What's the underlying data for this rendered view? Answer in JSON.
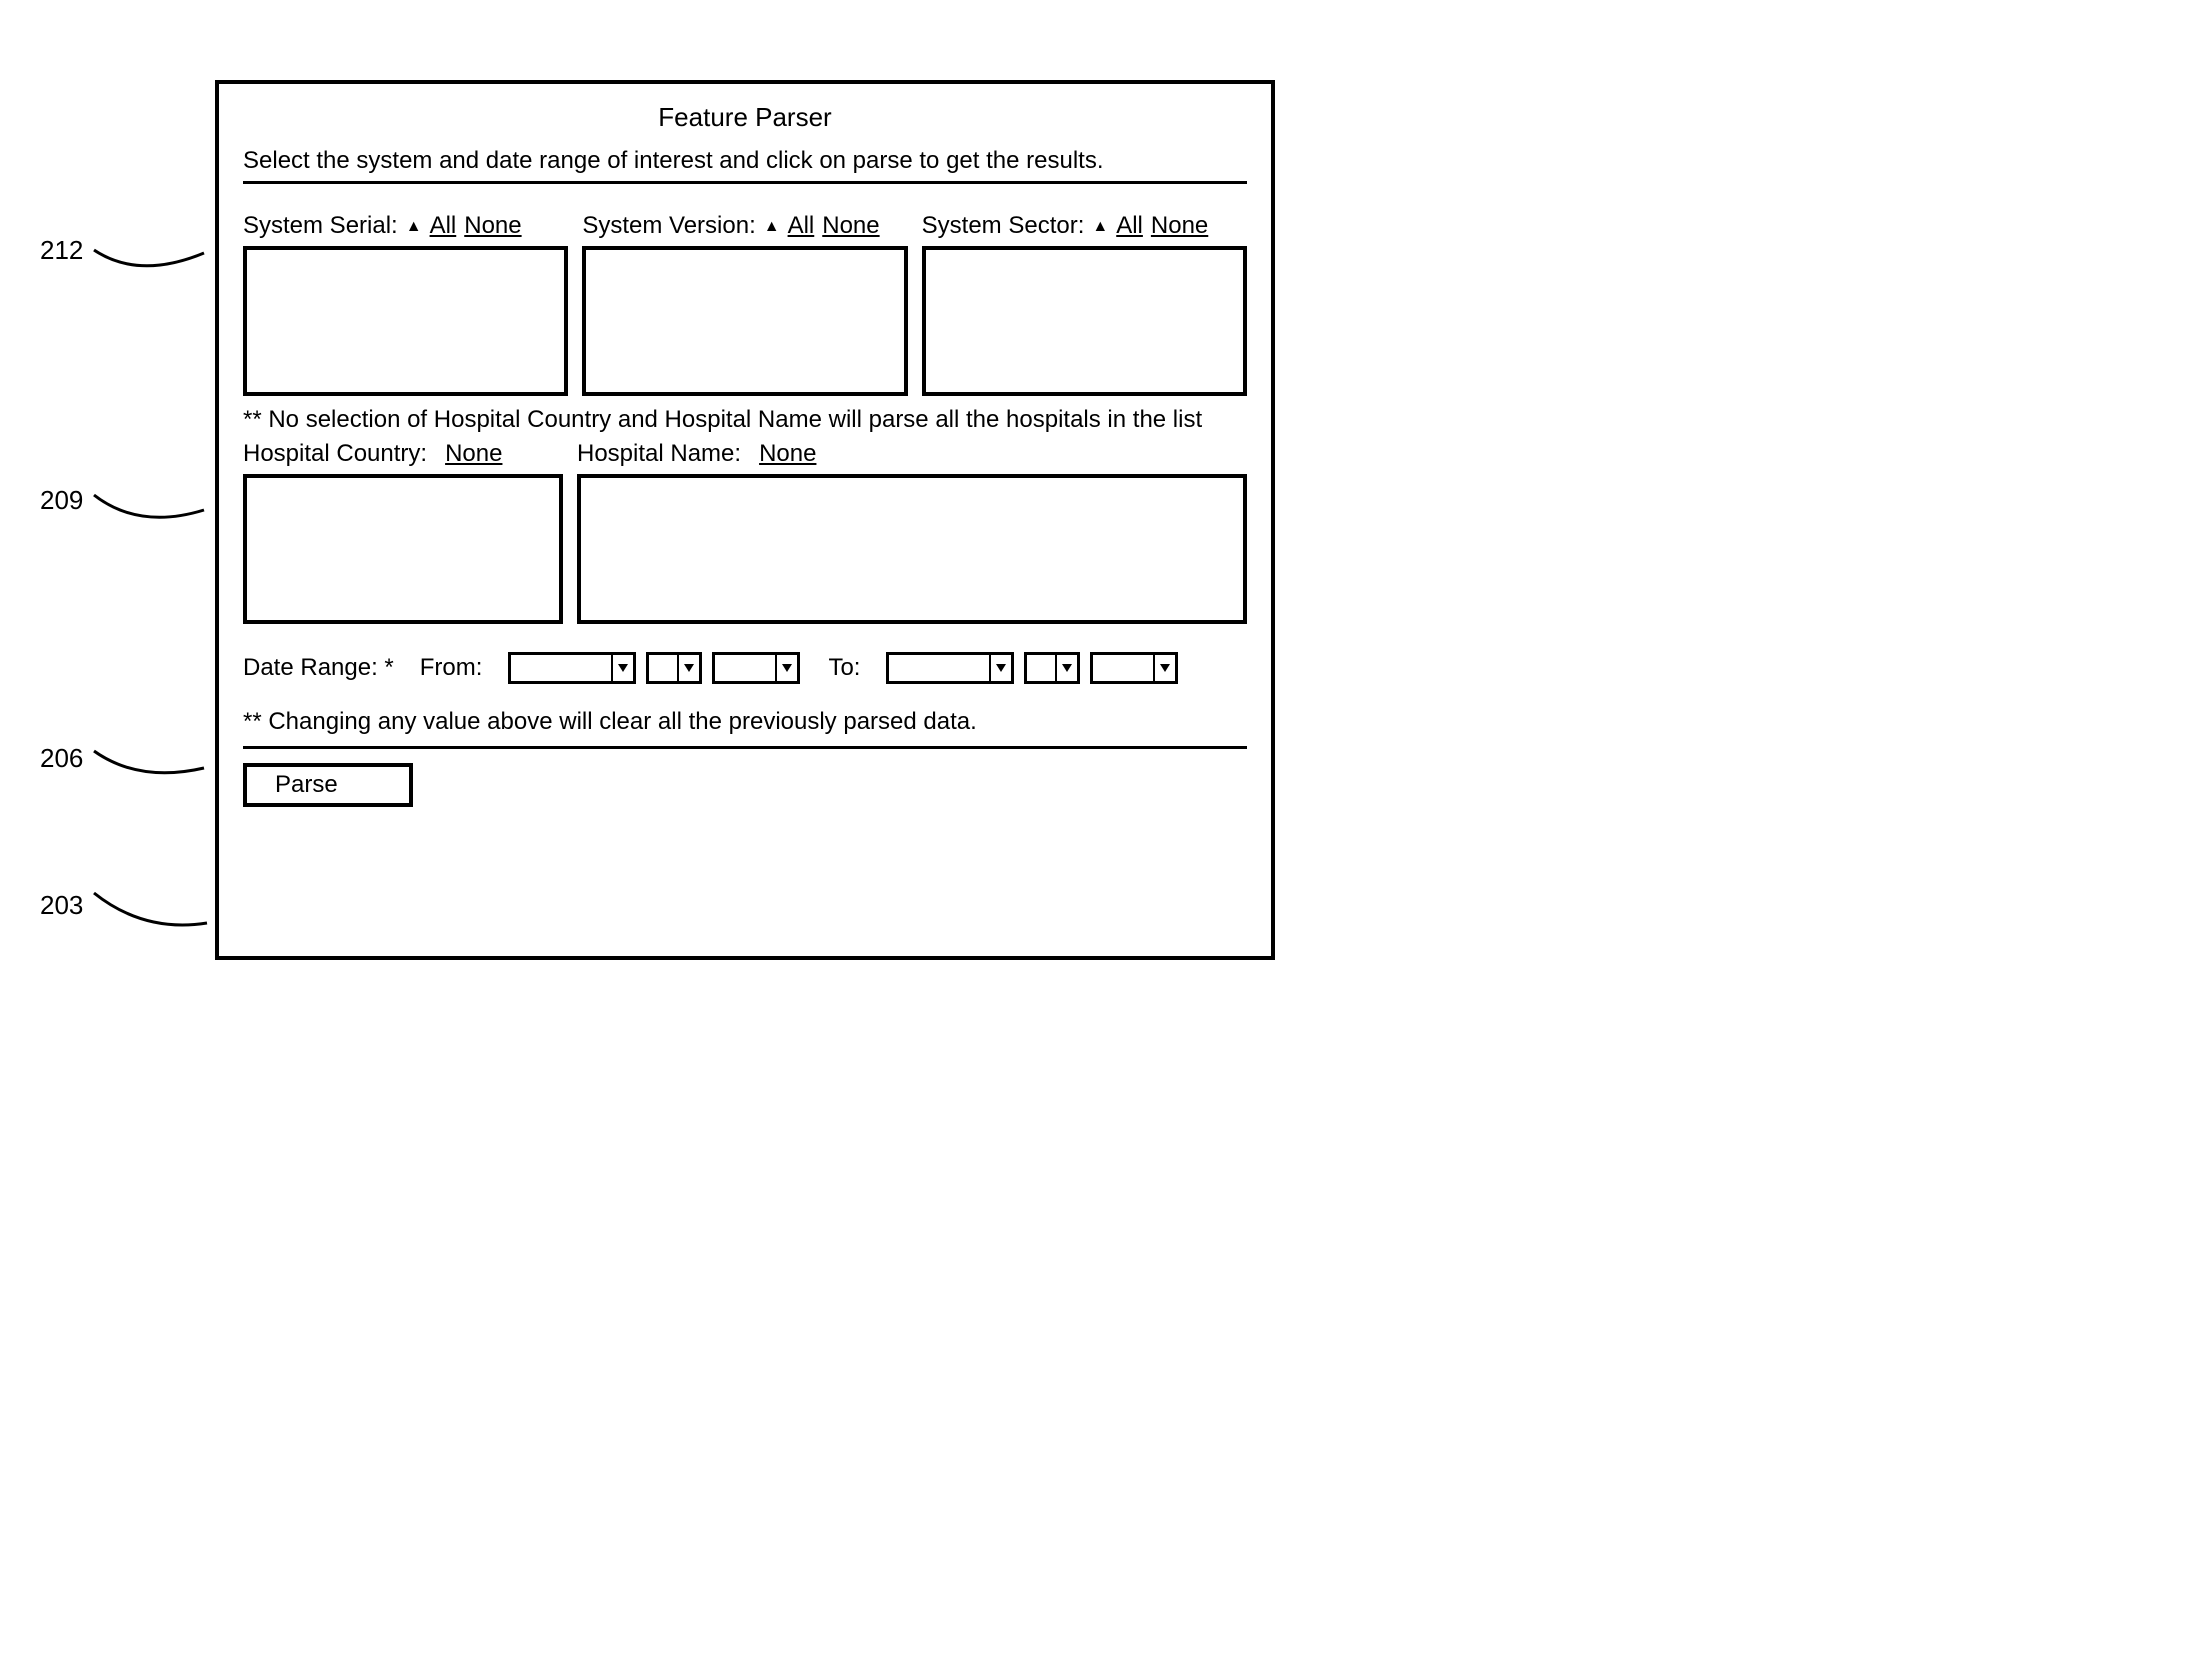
{
  "title": "Feature Parser",
  "instruction": "Select the system and date range of interest and click on parse to get the results.",
  "system": {
    "serial": {
      "label": "System Serial:",
      "all": "All",
      "none": "None"
    },
    "version": {
      "label": "System Version:",
      "all": "All",
      "none": "None"
    },
    "sector": {
      "label": "System Sector:",
      "all": "All",
      "none": "None"
    }
  },
  "hospital_note": "** No selection of Hospital Country and Hospital Name will parse all the hospitals in the list",
  "hospital": {
    "country": {
      "label": "Hospital Country:",
      "none": "None"
    },
    "name": {
      "label": "Hospital Name:",
      "none": "None"
    }
  },
  "date": {
    "label_prefix": "Date Range: *",
    "from": "From:",
    "to": "To:"
  },
  "warning": "** Changing any value above will clear all the previously parsed data.",
  "parse_button": "Parse",
  "callouts": {
    "c212": "212",
    "c209": "209",
    "c206": "206",
    "c203": "203"
  }
}
